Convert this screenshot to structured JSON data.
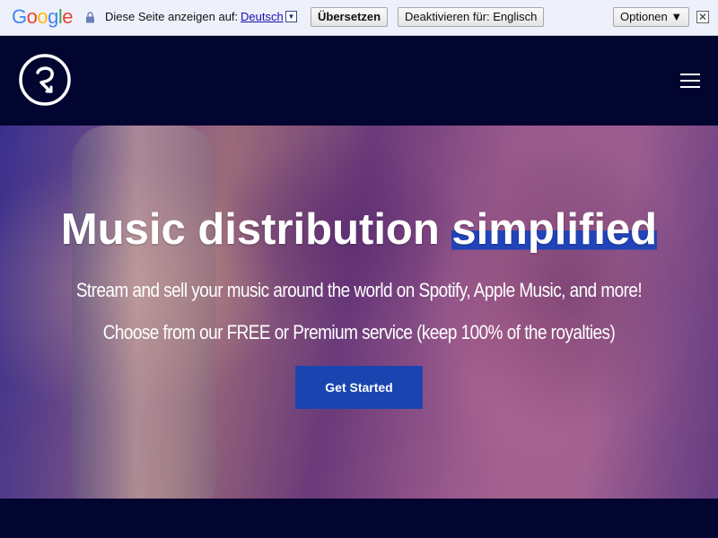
{
  "translate_bar": {
    "brand": [
      "G",
      "o",
      "o",
      "g",
      "l",
      "e"
    ],
    "brand_colors": [
      "#4285f4",
      "#ea4335",
      "#fbbc05",
      "#4285f4",
      "#34a853",
      "#ea4335"
    ],
    "prompt": "Diese Seite anzeigen auf:",
    "language": "Deutsch",
    "translate_button": "Übersetzen",
    "disable_button": "Deaktivieren für: Englisch",
    "options_button": "Optionen ▼",
    "close_icon": "close-icon"
  },
  "header": {
    "logo_icon": "brand-logo-icon",
    "menu_icon": "hamburger-menu-icon",
    "background": "#02052f"
  },
  "hero": {
    "title_main": "Music distribution ",
    "title_highlight": "simplified",
    "subtitle_1": "Stream and sell your music around the world on Spotify, Apple Music, and more!",
    "subtitle_2": "Choose from our FREE or Premium service (keep 100% of the royalties)",
    "cta_label": "Get Started",
    "accent_color": "#1a45b0"
  }
}
